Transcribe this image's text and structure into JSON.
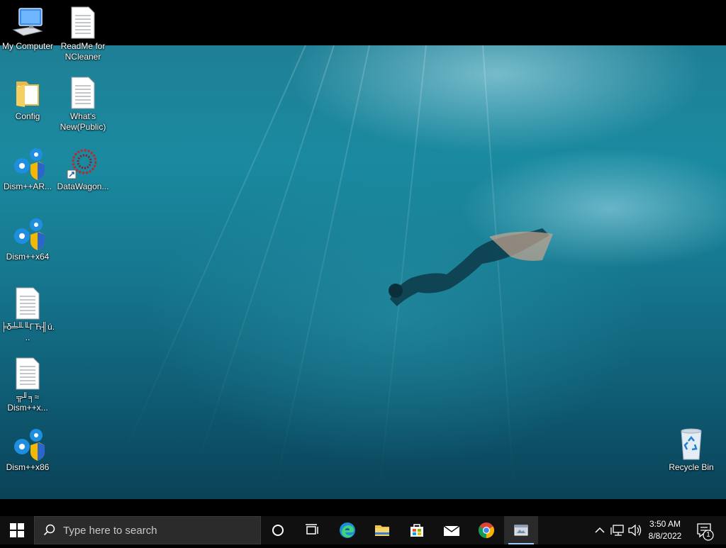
{
  "desktop": {
    "icons": [
      {
        "label": "My Computer"
      },
      {
        "label": "ReadMe for NCleaner"
      },
      {
        "label": "Config"
      },
      {
        "label": "What's New(Public)"
      },
      {
        "label": "Dism++AR..."
      },
      {
        "label": "DataWagon..."
      },
      {
        "label": "Dism++x64"
      },
      {
        "label": "╞δ╧╨╙ΓЋ╢ú..."
      },
      {
        "label": "╦╜╕≈ Dism++x..."
      },
      {
        "label": "Dism++x86"
      },
      {
        "label": "Recycle Bin"
      }
    ]
  },
  "taskbar": {
    "search_placeholder": "Type here to search",
    "apps": [
      "Cortana",
      "Task View",
      "Microsoft Edge",
      "File Explorer",
      "Microsoft Store",
      "Mail",
      "Google Chrome",
      "Active App"
    ],
    "clock": {
      "time": "3:50 AM",
      "date": "8/8/2022"
    },
    "notification_count": "1"
  },
  "colors": {
    "taskbar": "#101010",
    "accent": "#9ecbff"
  }
}
